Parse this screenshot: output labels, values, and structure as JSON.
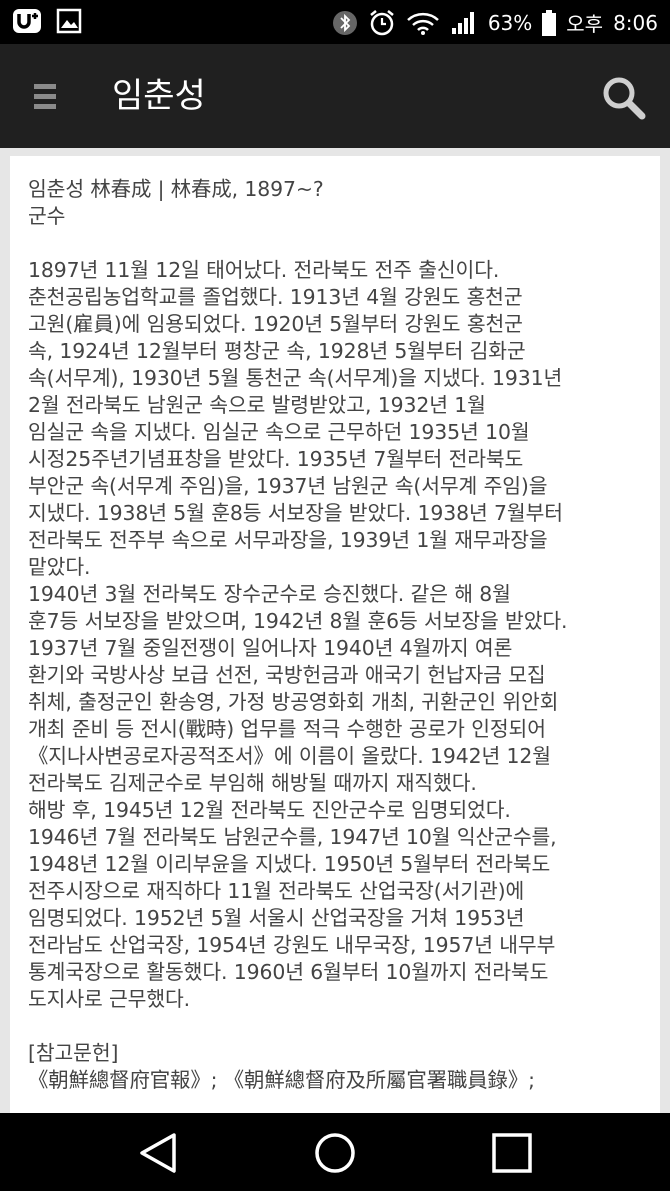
{
  "status_bar": {
    "battery": "63%",
    "ampm": "오후",
    "time": "8:06"
  },
  "app_bar": {
    "title": "임춘성"
  },
  "article": {
    "heading": "임춘성 林春成 | 林春成, 1897~?",
    "subtitle": "군수",
    "paragraphs": [
      "1897년 11월 12일 태어났다. 전라북도 전주 출신이다.\n춘천공립농업학교를 졸업했다. 1913년 4월 강원도 홍천군\n고원(雇員)에 임용되었다. 1920년 5월부터 강원도 홍천군\n속, 1924년 12월부터 평창군 속, 1928년 5월부터 김화군\n속(서무계), 1930년 5월 통천군 속(서무계)을 지냈다. 1931년\n2월 전라북도 남원군 속으로 발령받았고, 1932년 1월\n임실군 속을 지냈다. 임실군 속으로 근무하던 1935년 10월\n시정25주년기념표창을 받았다. 1935년 7월부터 전라북도\n부안군 속(서무계 주임)을, 1937년 남원군 속(서무계 주임)을\n지냈다. 1938년 5월 훈8등 서보장을 받았다. 1938년 7월부터\n전라북도 전주부 속으로 서무과장을, 1939년 1월 재무과장을\n맡았다.",
      "1940년 3월 전라북도 장수군수로 승진했다. 같은 해 8월\n훈7등 서보장을 받았으며, 1942년 8월 훈6등 서보장을 받았다.\n1937년 7월 중일전쟁이 일어나자 1940년 4월까지 여론\n환기와 국방사상 보급 선전, 국방헌금과 애국기 헌납자금 모집\n취체, 출정군인 환송영, 가정 방공영화회 개최, 귀환군인 위안회\n개최 준비 등 전시(戰時) 업무를 적극 수행한 공로가 인정되어\n《지나사변공로자공적조서》에 이름이 올랐다. 1942년 12월\n전라북도 김제군수로 부임해 해방될 때까지 재직했다.",
      "해방 후, 1945년 12월 전라북도 진안군수로 임명되었다.\n1946년 7월 전라북도 남원군수를, 1947년 10월 익산군수를,\n1948년 12월 이리부윤을 지냈다. 1950년 5월부터 전라북도\n전주시장으로 재직하다 11월 전라북도 산업국장(서기관)에\n임명되었다. 1952년 5월 서울시 산업국장을 거쳐 1953년\n전라남도 산업국장, 1954년 강원도 내무국장, 1957년 내무부\n통계국장으로 활동했다. 1960년 6월부터 10월까지 전라북도\n도지사로 근무했다."
    ],
    "references_heading": "[참고문헌]",
    "references": "《朝鮮總督府官報》; 《朝鮮總督府及所屬官署職員錄》;"
  }
}
